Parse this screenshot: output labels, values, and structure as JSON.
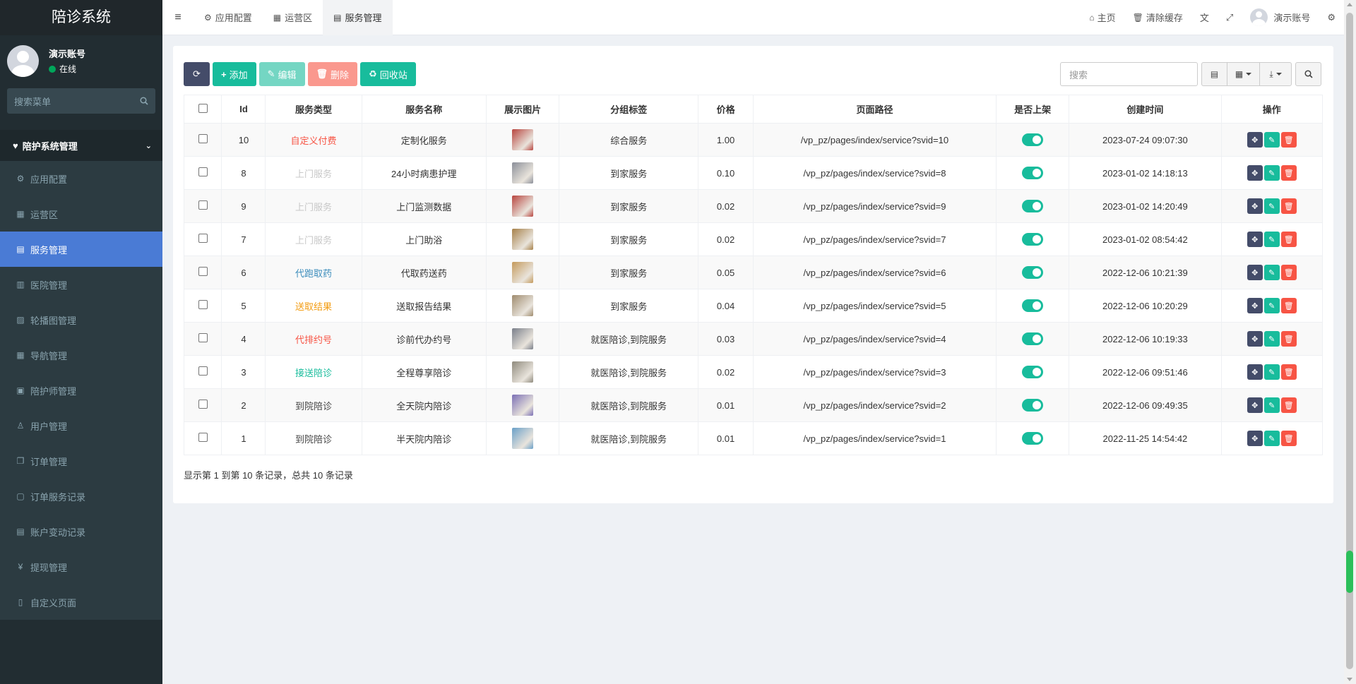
{
  "sidebar": {
    "logo": "陪诊系统",
    "user_name": "演示账号",
    "user_status": "在线",
    "search_placeholder": "搜索菜单",
    "group_label": "陪护系统管理",
    "items": [
      {
        "label": "应用配置",
        "icon": "gear-icon",
        "glyph": "⚙"
      },
      {
        "label": "运营区",
        "icon": "map-icon",
        "glyph": "▦"
      },
      {
        "label": "服务管理",
        "icon": "list-icon",
        "glyph": "▤"
      },
      {
        "label": "医院管理",
        "icon": "clipboard-icon",
        "glyph": "▥"
      },
      {
        "label": "轮播图管理",
        "icon": "image-icon",
        "glyph": "▨"
      },
      {
        "label": "导航管理",
        "icon": "grid-icon",
        "glyph": "▦"
      },
      {
        "label": "陪护师管理",
        "icon": "id-card-icon",
        "glyph": "▣"
      },
      {
        "label": "用户管理",
        "icon": "user-icon",
        "glyph": "♙"
      },
      {
        "label": "订单管理",
        "icon": "copy-icon",
        "glyph": "❐"
      },
      {
        "label": "订单服务记录",
        "icon": "save-icon",
        "glyph": "▢"
      },
      {
        "label": "账户变动记录",
        "icon": "calculator-icon",
        "glyph": "▤"
      },
      {
        "label": "提现管理",
        "icon": "yen-icon",
        "glyph": "¥"
      },
      {
        "label": "自定义页面",
        "icon": "file-icon",
        "glyph": "▯"
      }
    ]
  },
  "topbar": {
    "tabs": [
      {
        "label": "应用配置",
        "icon": "gear-icon",
        "glyph": "⚙"
      },
      {
        "label": "运营区",
        "icon": "map-icon",
        "glyph": "▦"
      },
      {
        "label": "服务管理",
        "icon": "list-icon",
        "glyph": "▤"
      }
    ],
    "home": "主页",
    "clear_cache": "清除缓存",
    "account": "演示账号"
  },
  "toolbar": {
    "add": "添加",
    "edit": "编辑",
    "delete": "删除",
    "recycle": "回收站",
    "search_placeholder": "搜索"
  },
  "table": {
    "headers": [
      "Id",
      "服务类型",
      "服务名称",
      "展示图片",
      "分组标签",
      "价格",
      "页面路径",
      "是否上架",
      "创建时间",
      "操作"
    ],
    "rows": [
      {
        "id": "10",
        "type": "自定义付费",
        "type_color": "#f75444",
        "name": "定制化服务",
        "img": "#b8453f",
        "tag": "综合服务",
        "price": "1.00",
        "path": "/vp_pz/pages/index/service?svid=10",
        "time": "2023-07-24 09:07:30"
      },
      {
        "id": "8",
        "type": "上门服务",
        "type_color": "#c8c8c8",
        "name": "24小时病患护理",
        "img": "#8b8f99",
        "tag": "到家服务",
        "price": "0.10",
        "path": "/vp_pz/pages/index/service?svid=8",
        "time": "2023-01-02 14:18:13"
      },
      {
        "id": "9",
        "type": "上门服务",
        "type_color": "#c8c8c8",
        "name": "上门监测数据",
        "img": "#b8453f",
        "tag": "到家服务",
        "price": "0.02",
        "path": "/vp_pz/pages/index/service?svid=9",
        "time": "2023-01-02 14:20:49"
      },
      {
        "id": "7",
        "type": "上门服务",
        "type_color": "#c8c8c8",
        "name": "上门助浴",
        "img": "#a7814a",
        "tag": "到家服务",
        "price": "0.02",
        "path": "/vp_pz/pages/index/service?svid=7",
        "time": "2023-01-02 08:54:42"
      },
      {
        "id": "6",
        "type": "代跑取药",
        "type_color": "#3c8dbc",
        "name": "代取药送药",
        "img": "#c49a5c",
        "tag": "到家服务",
        "price": "0.05",
        "path": "/vp_pz/pages/index/service?svid=6",
        "time": "2022-12-06 10:21:39"
      },
      {
        "id": "5",
        "type": "送取结果",
        "type_color": "#f39c12",
        "name": "送取报告结果",
        "img": "#9f8b6e",
        "tag": "到家服务",
        "price": "0.04",
        "path": "/vp_pz/pages/index/service?svid=5",
        "time": "2022-12-06 10:20:29"
      },
      {
        "id": "4",
        "type": "代排约号",
        "type_color": "#f75444",
        "name": "诊前代办约号",
        "img": "#7a7f8a",
        "tag": "就医陪诊,到院服务",
        "price": "0.03",
        "path": "/vp_pz/pages/index/service?svid=4",
        "time": "2022-12-06 10:19:33"
      },
      {
        "id": "3",
        "type": "接送陪诊",
        "type_color": "#18bc9c",
        "name": "全程尊享陪诊",
        "img": "#8f8a7d",
        "tag": "就医陪诊,到院服务",
        "price": "0.02",
        "path": "/vp_pz/pages/index/service?svid=3",
        "time": "2022-12-06 09:51:46"
      },
      {
        "id": "2",
        "type": "到院陪诊",
        "type_color": "#444444",
        "name": "全天院内陪诊",
        "img": "#7b6fb5",
        "tag": "就医陪诊,到院服务",
        "price": "0.01",
        "path": "/vp_pz/pages/index/service?svid=2",
        "time": "2022-12-06 09:49:35"
      },
      {
        "id": "1",
        "type": "到院陪诊",
        "type_color": "#444444",
        "name": "半天院内陪诊",
        "img": "#6aa0c8",
        "tag": "就医陪诊,到院服务",
        "price": "0.01",
        "path": "/vp_pz/pages/index/service?svid=1",
        "time": "2022-11-25 14:54:42"
      }
    ]
  },
  "pager_text": "显示第 1 到第 10 条记录，总共 10 条记录",
  "colors": {
    "accent": "#4a7bd5",
    "success": "#18bc9c",
    "danger": "#f75444",
    "dark": "#444c69"
  }
}
